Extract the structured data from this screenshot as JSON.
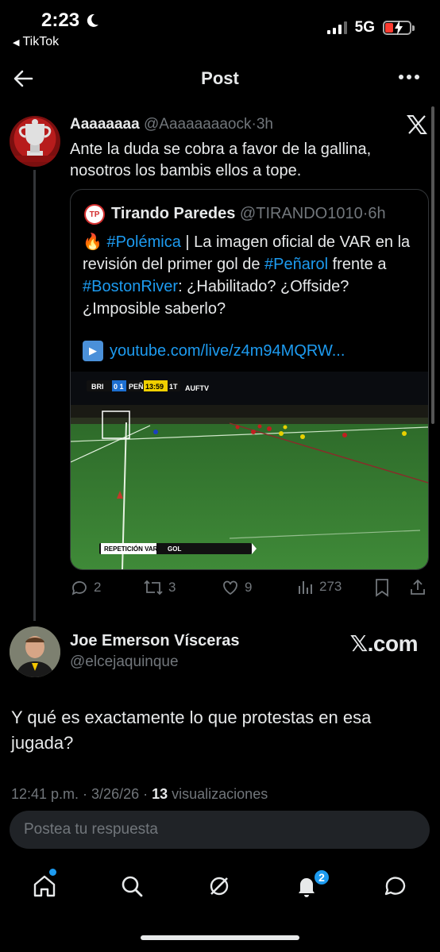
{
  "status": {
    "time": "2:23",
    "back_app": "TikTok",
    "network": "5G"
  },
  "header": {
    "title": "Post"
  },
  "quoted_tweet_parent": {
    "display_name": "Aaaaaaaa",
    "handle": "@Aaaaaaaaock",
    "time": "3h",
    "text": "Ante la duda se cobra a favor de la gallina, nosotros los bambis ellos a tope.",
    "quote": {
      "avatar_initials": "TP",
      "display_name": "Tirando Paredes",
      "handle": "@TIRANDO1010",
      "time": "6h",
      "fire_emoji": "🔥",
      "hashtag1": "#Polémica",
      "text1": " | La imagen oficial de VAR en la revisión del primer gol de ",
      "hashtag2": "#Peñarol",
      "text2": " frente a ",
      "hashtag3": "#BostonRiver",
      "text3": ": ¿Habilitado? ¿Offside? ¿Imposible saberlo?",
      "link": "youtube.com/live/z4m94MQRW...",
      "media": {
        "score_home": "BRI",
        "score": "0 1",
        "score_away": "PEÑ",
        "clock": "13:59",
        "half": "1T",
        "broadcaster": "AUFTV",
        "banner_left": "REPETICIÓN VAR",
        "banner_right": "GOL"
      }
    },
    "actions": {
      "replies": "2",
      "retweets": "3",
      "likes": "9",
      "views": "273"
    }
  },
  "main_tweet": {
    "display_name": "Joe Emerson Vísceras",
    "handle": "@elcejaquinque",
    "source_logo": "𝕏.com",
    "text": "Y qué es exactamente lo que protestas en esa jugada?",
    "timestamp": "12:41 p.m. · 3/26/26 · ",
    "views_count": "13",
    "views_label": " visualizaciones"
  },
  "reply": {
    "placeholder": "Postea tu respuesta"
  },
  "nav": {
    "notifications_badge": "2"
  },
  "colors": {
    "accent": "#1d9bf0",
    "background": "#000000",
    "muted": "#71767b"
  }
}
